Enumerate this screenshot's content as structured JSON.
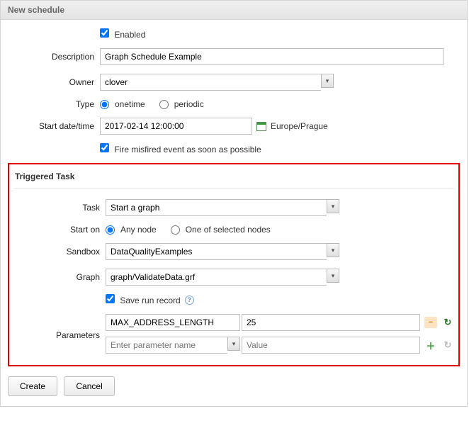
{
  "header": {
    "title": "New schedule"
  },
  "form": {
    "enabled_label": "Enabled",
    "description_label": "Description",
    "description_value": "Graph Schedule Example",
    "owner_label": "Owner",
    "owner_value": "clover",
    "type_label": "Type",
    "type_onetime": "onetime",
    "type_periodic": "periodic",
    "startdt_label": "Start date/time",
    "startdt_value": "2017-02-14 12:00:00",
    "timezone": "Europe/Prague",
    "fire_misfired_label": "Fire misfired event as soon as possible"
  },
  "triggered": {
    "section_title": "Triggered Task",
    "task_label": "Task",
    "task_value": "Start a graph",
    "starton_label": "Start on",
    "starton_any": "Any node",
    "starton_one": "One of selected nodes",
    "sandbox_label": "Sandbox",
    "sandbox_value": "DataQualityExamples",
    "graph_label": "Graph",
    "graph_value": "graph/ValidateData.grf",
    "save_run_label": "Save run record",
    "parameters_label": "Parameters",
    "params": [
      {
        "name": "MAX_ADDRESS_LENGTH",
        "value": "25"
      }
    ],
    "param_name_placeholder": "Enter parameter name",
    "param_value_placeholder": "Value"
  },
  "buttons": {
    "create": "Create",
    "cancel": "Cancel"
  }
}
